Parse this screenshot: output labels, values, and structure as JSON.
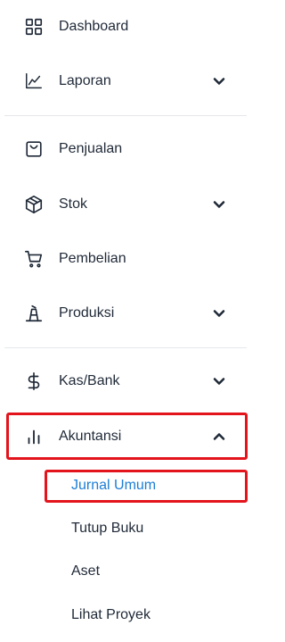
{
  "menu": {
    "dashboard": "Dashboard",
    "laporan": "Laporan",
    "penjualan": "Penjualan",
    "stok": "Stok",
    "pembelian": "Pembelian",
    "produksi": "Produksi",
    "kas_bank": "Kas/Bank",
    "akuntansi": "Akuntansi"
  },
  "submenu": {
    "jurnal_umum": "Jurnal Umum",
    "tutup_buku": "Tutup Buku",
    "aset": "Aset",
    "lihat_proyek": "Lihat Proyek"
  },
  "icons": {
    "dashboard": "grid-icon",
    "laporan": "line-chart-icon",
    "penjualan": "shopping-bag-icon",
    "stok": "box-icon",
    "pembelian": "cart-icon",
    "produksi": "factory-icon",
    "kas_bank": "dollar-icon",
    "akuntansi": "bar-chart-icon"
  },
  "colors": {
    "active_link": "#1c7ed6",
    "highlight": "#e3141c"
  }
}
